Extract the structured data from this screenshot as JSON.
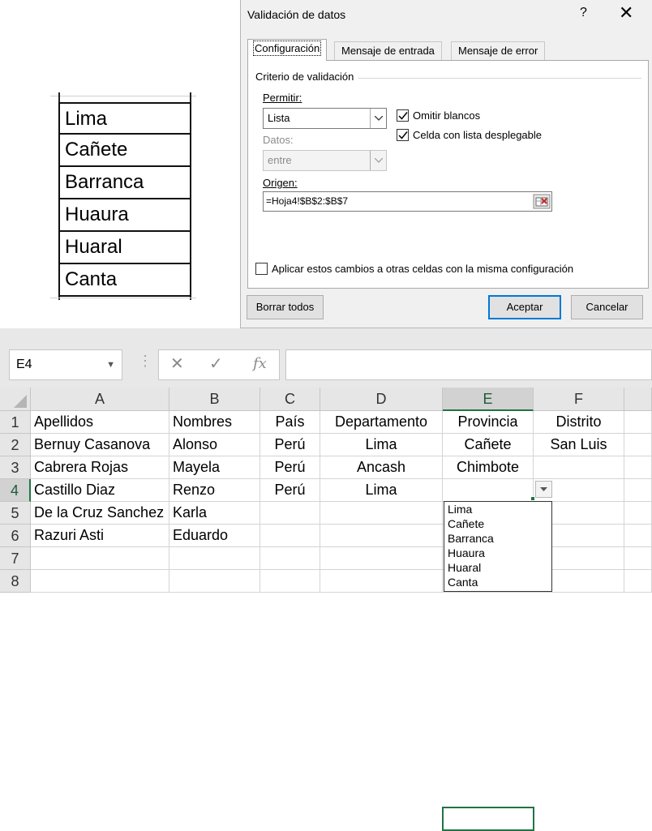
{
  "source_list": [
    "Lima",
    "Cañete",
    "Barranca",
    "Huaura",
    "Huaral",
    "Canta"
  ],
  "dialog": {
    "title": "Validación de datos",
    "help": "?",
    "close": "✕",
    "tabs": [
      "Configuración",
      "Mensaje de entrada",
      "Mensaje de error"
    ],
    "criteria_title": "Criterio de validación",
    "permitir_label": "Permitir:",
    "permitir_value": "Lista",
    "omitir_blancos": "Omitir blancos",
    "celda_lista": "Celda con lista desplegable",
    "datos_label": "Datos:",
    "datos_value": "entre",
    "origen_label": "Origen:",
    "origen_value": "=Hoja4!$B$2:$B$7",
    "apply_all": "Aplicar estos cambios a otras celdas con la misma configuración",
    "clear_btn": "Borrar todos",
    "ok_btn": "Aceptar",
    "cancel_btn": "Cancelar"
  },
  "excel": {
    "name_box": "E4",
    "formula": "",
    "fx": "fx",
    "columns": [
      "A",
      "B",
      "C",
      "D",
      "E",
      "F"
    ],
    "rows": [
      "1",
      "2",
      "3",
      "4",
      "5",
      "6",
      "7",
      "8"
    ],
    "cells": [
      [
        "Apellidos",
        "Nombres",
        "País",
        "Departamento",
        "Provincia",
        "Distrito"
      ],
      [
        "Bernuy Casanova",
        "Alonso",
        "Perú",
        "Lima",
        "Cañete",
        "San Luis"
      ],
      [
        "Cabrera Rojas",
        "Mayela",
        "Perú",
        "Ancash",
        "Chimbote",
        ""
      ],
      [
        "Castillo Diaz",
        "Renzo",
        "Perú",
        "Lima",
        "",
        ""
      ],
      [
        "De la Cruz Sanchez",
        "Karla",
        "",
        "",
        "",
        ""
      ],
      [
        "Razuri Asti",
        "Eduardo",
        "",
        "",
        "",
        ""
      ],
      [
        "",
        "",
        "",
        "",
        "",
        ""
      ],
      [
        "",
        "",
        "",
        "",
        "",
        ""
      ]
    ],
    "dropdown_items": [
      "Lima",
      "Cañete",
      "Barranca",
      "Huaura",
      "Huaral",
      "Canta"
    ],
    "accent": "#217346"
  }
}
